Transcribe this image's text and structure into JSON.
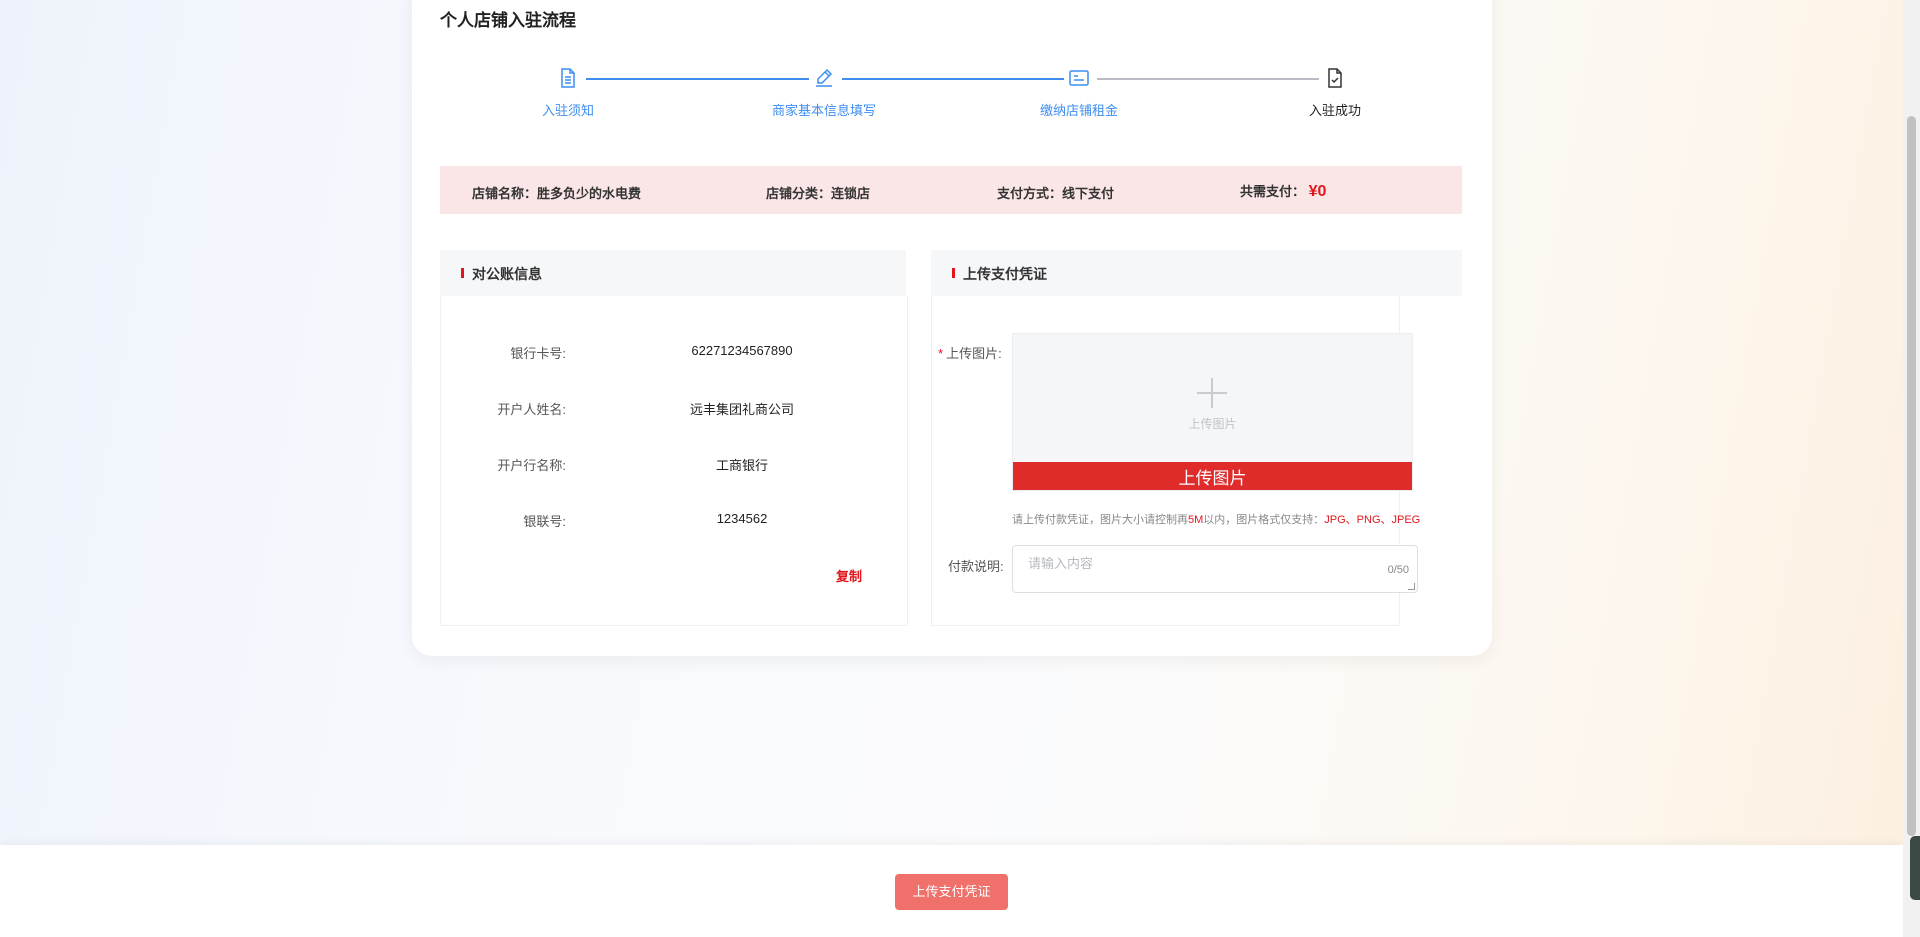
{
  "page": {
    "title": "个人店铺入驻流程"
  },
  "steps": [
    {
      "label": "入驻须知",
      "status": "done",
      "icon": "document-icon"
    },
    {
      "label": "商家基本信息填写",
      "status": "done",
      "icon": "pencil-icon"
    },
    {
      "label": "缴纳店铺租金",
      "status": "done",
      "icon": "card-icon"
    },
    {
      "label": "入驻成功",
      "status": "current",
      "icon": "document-check-icon"
    }
  ],
  "summary": {
    "shop_name": "店铺名称：胜多负少的水电费",
    "shop_category": "店铺分类：连锁店",
    "payment_method": "支付方式：线下支付",
    "total_label": "共需支付：",
    "total_amount": "¥0"
  },
  "account": {
    "title": "对公账信息",
    "rows": [
      {
        "label": "银行卡号:",
        "value": "62271234567890"
      },
      {
        "label": "开户人姓名:",
        "value": "远丰集团礼商公司"
      },
      {
        "label": "开户行名称:",
        "value": "工商银行"
      },
      {
        "label": "银联号:",
        "value": "1234562"
      }
    ],
    "copy_label": "复制"
  },
  "upload": {
    "title": "上传支付凭证",
    "image_label": "上传图片:",
    "image_hint": "上传图片",
    "image_button": "上传图片",
    "note_prefix": "请上传付款凭证，图片大小请控制再",
    "note_size": "5M",
    "note_middle": "以内，图片格式仅支持：",
    "note_formats": "JPG、PNG、JPEG",
    "desc_label": "付款说明:",
    "desc_placeholder": "请输入内容",
    "desc_count": "0/50"
  },
  "footer": {
    "submit_label": "上传支付凭证"
  },
  "colors": {
    "accent_red": "#e1161d",
    "step_blue": "#3d8ef0",
    "summary_bg": "#fbe6e7",
    "submit_bg": "#f0706b"
  }
}
